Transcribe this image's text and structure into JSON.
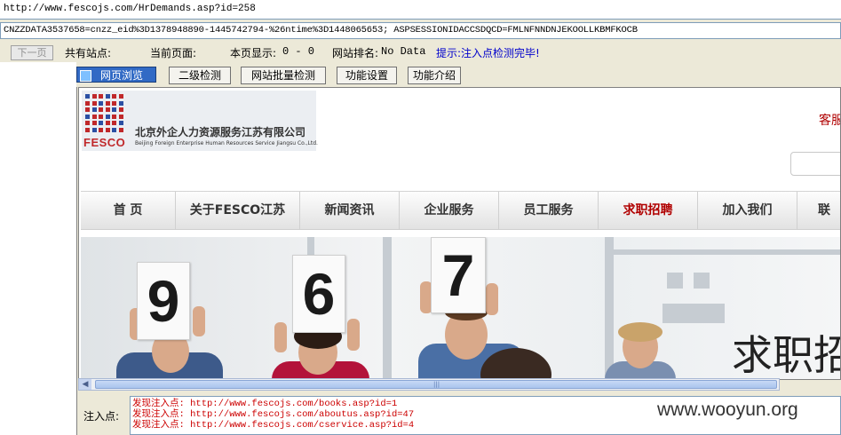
{
  "address": {
    "url": "http://www.fescojs.com/HrDemands.asp?id=258"
  },
  "cookie": {
    "value": "CNZZDATA3537658=cnzz_eid%3D1378948890-1445742794-%26ntime%3D1448065653; ASPSESSIONIDACCSDQCD=FMLNFNNDNJEKOOLLKBMFKOCB"
  },
  "info_bar": {
    "next_label": "下一页",
    "total_sites_label": "共有站点:",
    "current_page_label": "当前页面:",
    "page_display_label": "本页显示:",
    "page_display_value": "0 - 0",
    "site_rank_label": "网站排名:",
    "site_rank_value": "No Data",
    "hint": "提示:注入点检测完毕!",
    "hint_color": "#0000cc"
  },
  "tabs": [
    {
      "label": "网页浏览",
      "active": true
    },
    {
      "label": "二级检测"
    },
    {
      "label": "网站批量检测"
    },
    {
      "label": "功能设置"
    },
    {
      "label": "功能介绍"
    }
  ],
  "site": {
    "logo_mark": "FESCO",
    "company_cn": "北京外企人力资源服务江苏有限公司",
    "company_en": "Beijing Foreign Enterprise Human Resources Service Jiangsu Co.,Ltd.",
    "header_right_text": "客服",
    "brand_color": "#c0282a",
    "nav": [
      {
        "label": "首 页"
      },
      {
        "label": "关于FESCO江苏"
      },
      {
        "label": "新闻资讯"
      },
      {
        "label": "企业服务"
      },
      {
        "label": "员工服务"
      },
      {
        "label": "求职招聘",
        "active": true
      },
      {
        "label": "加入我们"
      },
      {
        "label": "联"
      }
    ],
    "banner": {
      "cards": [
        "9",
        "6",
        "7"
      ],
      "text": "求职招"
    }
  },
  "injection": {
    "label": "注入点:",
    "items": [
      "发现注入点: http://www.fescojs.com/books.asp?id=1",
      "发现注入点: http://www.fescojs.com/aboutus.asp?id=47",
      "发现注入点: http://www.fescojs.com/cservice.asp?id=4"
    ]
  },
  "watermark": "www.wooyun.org"
}
